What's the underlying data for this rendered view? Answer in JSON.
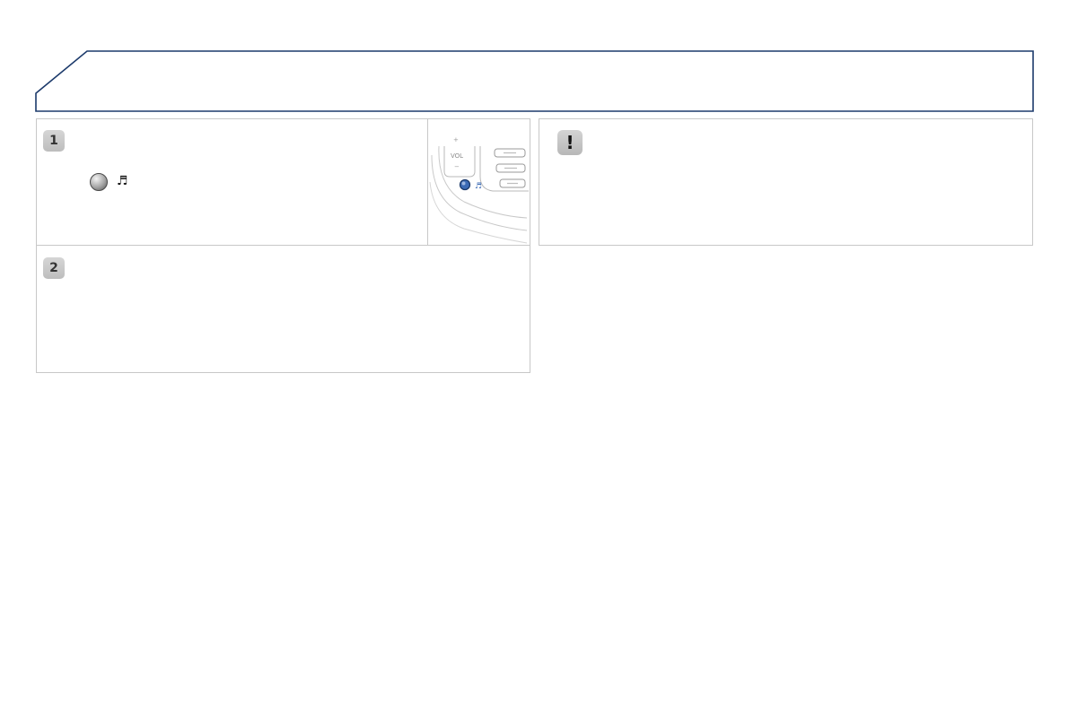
{
  "steps": [
    {
      "number": "1"
    },
    {
      "number": "2"
    }
  ],
  "warning": {
    "symbol": "!"
  },
  "illustration": {
    "volume_label": "VOL",
    "plus_sign": "+",
    "minus_sign": "−"
  },
  "icons": {
    "media_knob": "round-knob-icon",
    "music": "music-note-icon"
  },
  "glyphs": {
    "music_note": "♬"
  },
  "colors": {
    "header_border": "#1c3a6b",
    "box_border": "#c8c8c8",
    "badge_gray": "#c6c6c6",
    "knob_blue": "#3c6bb5"
  }
}
